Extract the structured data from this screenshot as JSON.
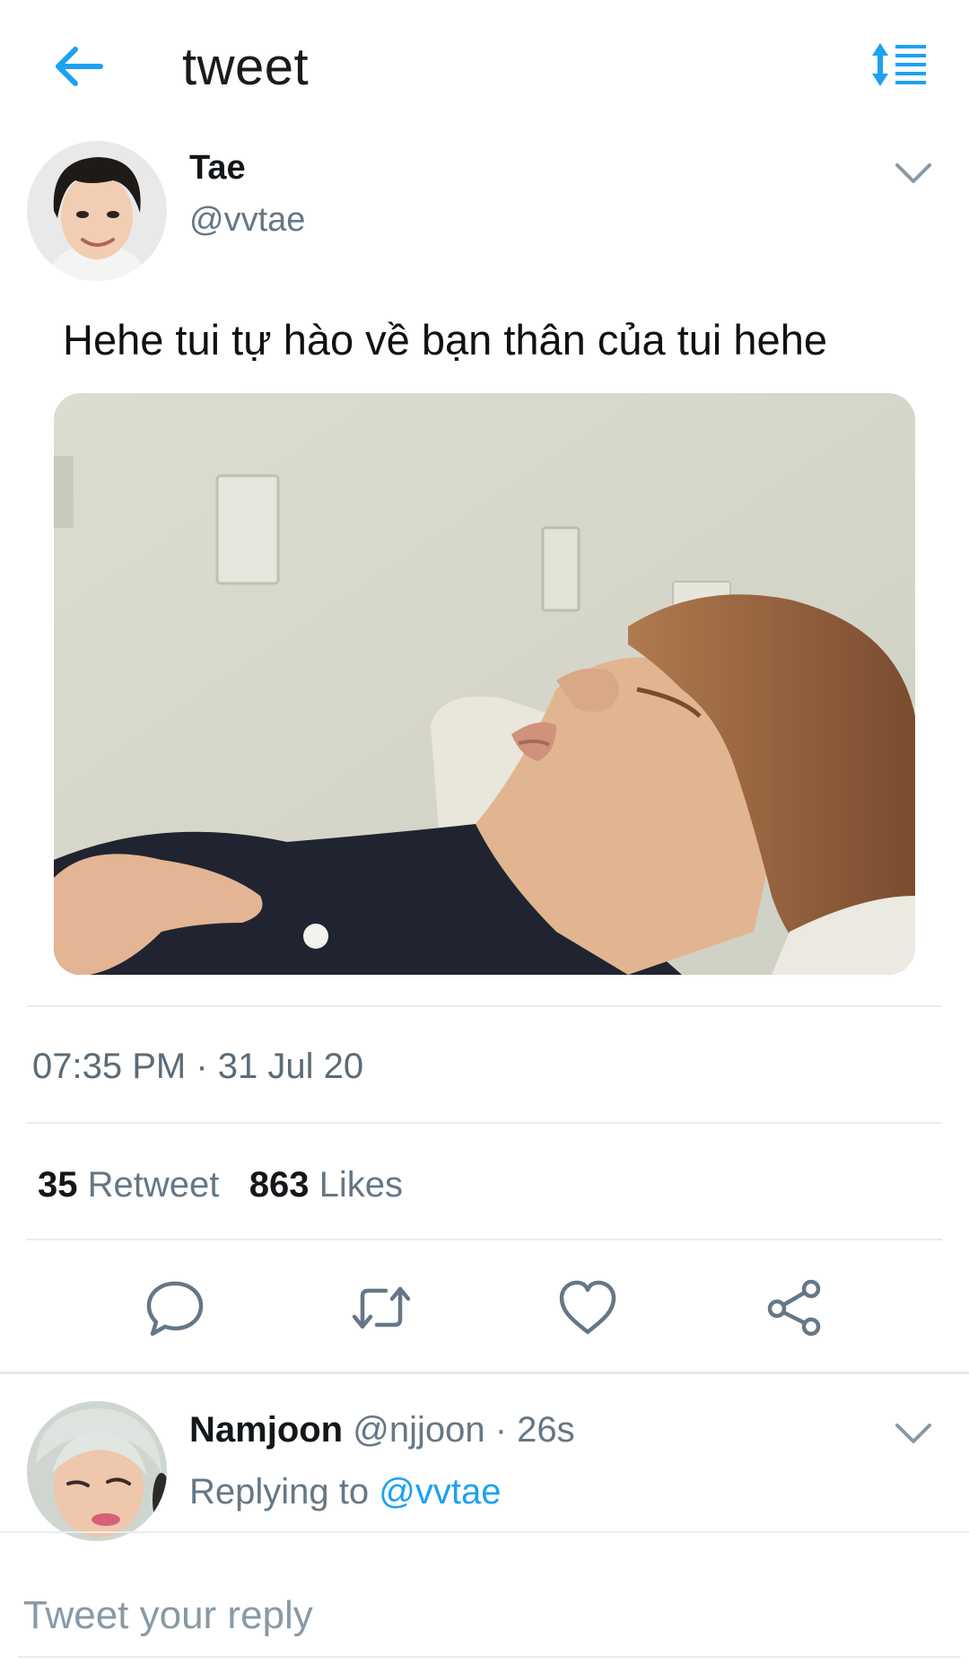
{
  "header": {
    "title": "tweet",
    "back_icon": "arrow-left-icon",
    "sort_icon": "sort-list-icon",
    "accent_color": "#1da1f2"
  },
  "tweet": {
    "author": {
      "name": "Tae",
      "handle": "@vvtae"
    },
    "text": "Hehe tui tự hào về bạn thân của tui hehe",
    "timestamp": "07:35 PM · 31 Jul 20",
    "stats": {
      "retweets": "35",
      "retweets_label": "Retweet",
      "likes": "863",
      "likes_label": "Likes"
    },
    "actions": [
      "reply-icon",
      "retweet-icon",
      "heart-icon",
      "share-icon"
    ]
  },
  "reply": {
    "name": "Namjoon",
    "meta": "@njjoon · 26s",
    "replying_prefix": "Replying to",
    "replying_to": "@vvtae"
  },
  "reply_input": {
    "placeholder": "Tweet your reply"
  }
}
